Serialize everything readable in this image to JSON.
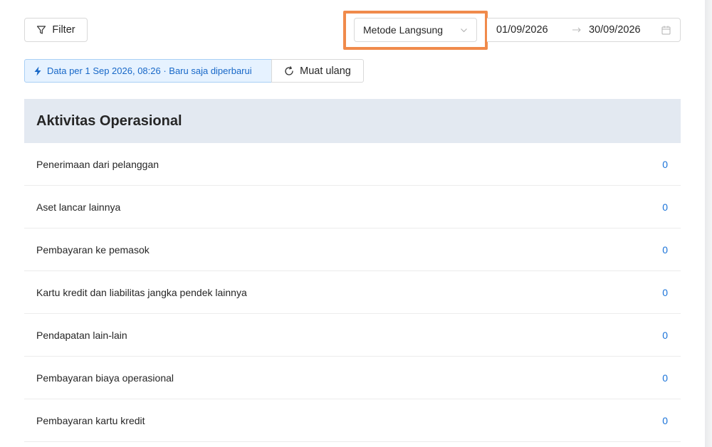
{
  "toolbar": {
    "filter_label": "Filter",
    "method_select": {
      "value": "Metode Langsung",
      "icon": "chevron-down-icon"
    },
    "date_range": {
      "start": "01/09/2026",
      "end": "30/09/2026",
      "separator_icon": "arrow-right-icon",
      "icon": "calendar-icon"
    }
  },
  "info": {
    "status_text": "Data per 1 Sep 2026, 08:26 · Baru saja diperbarui",
    "status_icon": "lightning-icon",
    "reload_label": "Muat ulang",
    "reload_icon": "reload-icon"
  },
  "section": {
    "title": "Aktivitas Operasional",
    "rows": [
      {
        "label": "Penerimaan dari pelanggan",
        "value": "0"
      },
      {
        "label": "Aset lancar lainnya",
        "value": "0"
      },
      {
        "label": "Pembayaran ke pemasok",
        "value": "0"
      },
      {
        "label": "Kartu kredit dan liabilitas jangka pendek lainnya",
        "value": "0"
      },
      {
        "label": "Pendapatan lain-lain",
        "value": "0"
      },
      {
        "label": "Pembayaran biaya operasional",
        "value": "0"
      },
      {
        "label": "Pembayaran kartu kredit",
        "value": "0"
      }
    ]
  },
  "colors": {
    "highlight": "#f08a4b",
    "accent": "#1a73d9",
    "section_bg": "#e3e9f1",
    "info_bg": "#e6f2ff"
  }
}
